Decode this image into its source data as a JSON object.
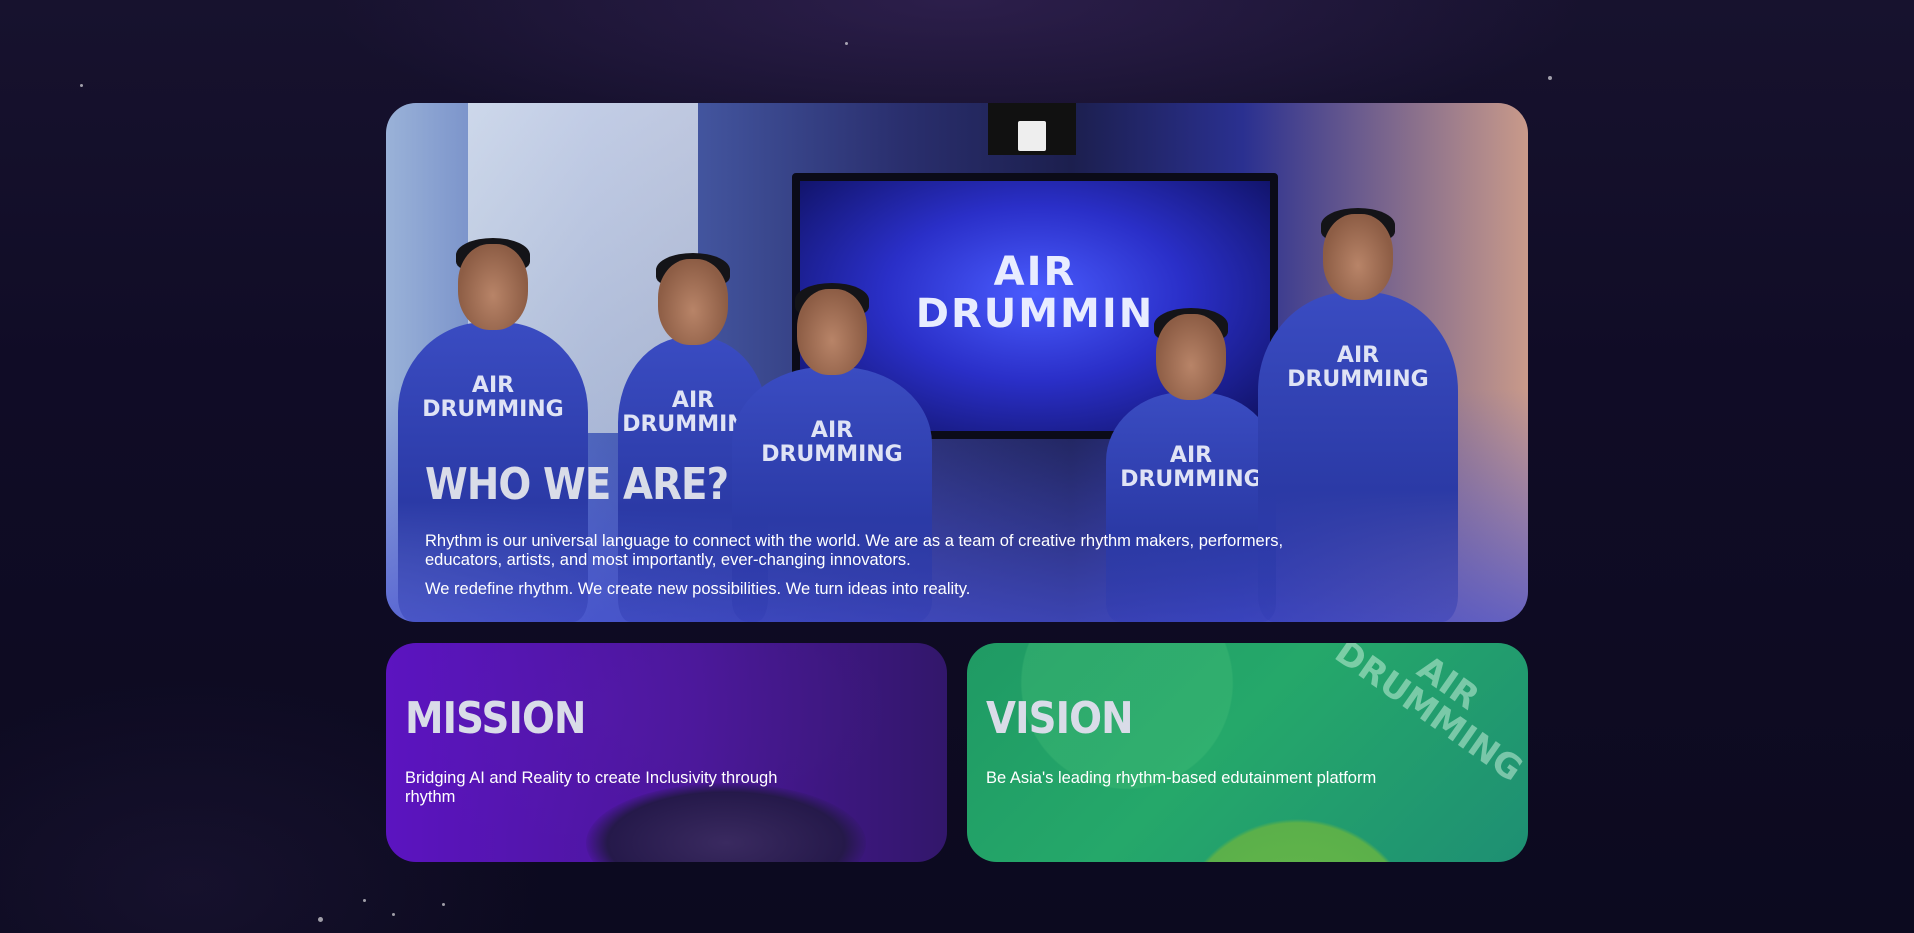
{
  "hero": {
    "title": "WHO WE ARE?",
    "paragraph_1": "Rhythm is our universal language to connect with the world. We are as a team of creative rhythm makers, performers, educators, artists, and most importantly, ever-changing innovators.",
    "paragraph_2": "We redefine rhythm. We create new possibilities. We turn ideas into reality.",
    "photo": {
      "screen_text": "AIR\nDRUMMIN",
      "shirt_text": "AIR\nDRUMMING"
    }
  },
  "mission": {
    "title": "MISSION",
    "text": "Bridging AI and Reality to create Inclusivity through rhythm"
  },
  "vision": {
    "title": "VISION",
    "text": "Be Asia's leading rhythm-based edutainment platform",
    "watermark": "AIR\nDRUMMING"
  },
  "colors": {
    "page_background": "#0e0b22",
    "hero_overlay": "#4650d2",
    "mission_accent": "#5f14c8",
    "vision_accent": "#25a86a",
    "heading_text": "#d9dce8",
    "body_text": "#ffffff"
  }
}
